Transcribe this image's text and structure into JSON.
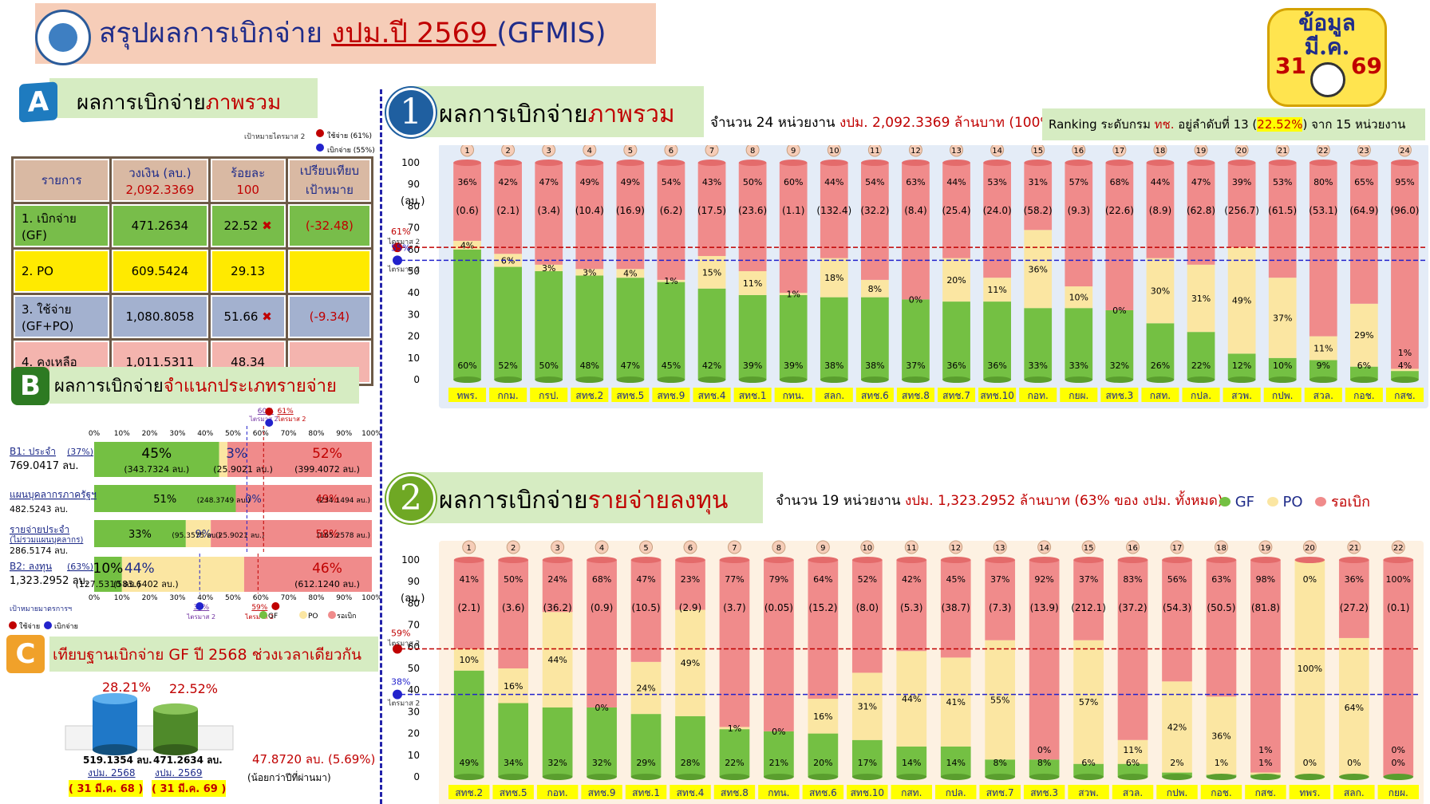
{
  "header": {
    "title_pre": "สรุปผลการเบิกจ่าย ",
    "title_u": "งปม.ปี 2569 ",
    "title_post": "(GFMIS)"
  },
  "clock": {
    "label1": "ข้อมูล",
    "label2": "มี.ค.",
    "day": "31",
    "year": "69"
  },
  "secA": {
    "letter": "A",
    "pre": "ผลการเบิกจ่าย",
    "hl": "ภาพรวม",
    "legend_target": "เป้าหมายไตรมาส 2",
    "legend_spend": "ใช้จ่าย (61%)",
    "legend_disb": "เบิกจ่าย (55%)"
  },
  "tableA": {
    "headers": [
      "รายการ",
      "วงเงิน (ลบ.)",
      "ร้อยละ",
      "เปรียบเทียบ"
    ],
    "headers2": [
      "",
      "2,092.3369",
      "100",
      "เป้าหมาย"
    ],
    "rows": [
      {
        "c1": "1. เบิกจ่าย",
        "c1b": "(GF)",
        "c2": "471.2634",
        "c3": "22.52",
        "c4": "(-32.48)",
        "x": "✖"
      },
      {
        "c1": "2. PO",
        "c1b": "",
        "c2": "609.5424",
        "c3": "29.13",
        "c4": "",
        "x": ""
      },
      {
        "c1": "3. ใช้จ่าย",
        "c1b": "(GF+PO)",
        "c2": "1,080.8058",
        "c3": "51.66",
        "c4": "(-9.34)",
        "x": "✖"
      },
      {
        "c1": "4. คงเหลือ",
        "c1b": "",
        "c2": "1,011.5311",
        "c3": "48.34",
        "c4": "",
        "x": ""
      }
    ]
  },
  "secB": {
    "letter": "B",
    "pre": "ผลการเบิกจ่าย",
    "hl": "จำแนกประเภทรายจ่าย",
    "ticks": [
      "0%",
      "10%",
      "20%",
      "30%",
      "40%",
      "50%",
      "60%",
      "70%",
      "80%",
      "90%",
      "100%"
    ],
    "mark60": "60%",
    "mark60b": "ไตรมาส 2",
    "mark61": "61%",
    "mark61b": "ไตรมาส 2",
    "rows": [
      {
        "lbl": "B1: ประจำ",
        "pct": "(37%)",
        "amt": "769.0417 ลบ.",
        "gf": "45%",
        "gf_amt": "(343.7324 ลบ.)",
        "po": "3%",
        "po_amt": "(25.9021 ลบ.)",
        "rem": "52%",
        "rem_amt": "(399.4072 ลบ.)",
        "g": 45,
        "p": 3
      },
      {
        "lbl": "แผนบุคลากรภาครัฐฯ",
        "pct": "",
        "amt": "482.5243 ลบ.",
        "gf": "51%",
        "gf_amt": "(248.3749 ลบ.)",
        "po": "0%",
        "po_amt": "",
        "rem": "49%",
        "rem_amt": "(234.1494 ลบ.)",
        "g": 51,
        "p": 0
      },
      {
        "lbl": "รายจ่ายประจำ",
        "pct": "(ไม่รวมแผนบุคลากร)",
        "amt": "286.5174 ลบ.",
        "gf": "33%",
        "gf_amt": "(95.3575 ลบ.)",
        "po": "9%",
        "po_amt": "(25.9021 ลบ.)",
        "rem": "58%",
        "rem_amt": "(165.2578 ลบ.)",
        "g": 33,
        "p": 9
      },
      {
        "lbl": "B2: ลงทุน",
        "pct": "(63%)",
        "amt": "1,323.2952 ลบ.",
        "gf": "10%",
        "gf_amt": "(127.5310 ลบ.)",
        "po": "44%",
        "po_amt": "(583.6402 ลบ.)",
        "rem": "46%",
        "rem_amt": "(612.1240 ลบ.)",
        "g": 10,
        "p": 44
      }
    ],
    "mark38": "38%",
    "mark38b": "ไตรมาส 2",
    "mark59": "59%",
    "mark59b": "ไตรมาส 2",
    "legend_target": "เป้าหมายมาตรการฯ",
    "legend_spend": "ใช้จ่าย",
    "legend_disb": "เบิกจ่าย",
    "legend": [
      "GF",
      "PO",
      "รอเบิก"
    ]
  },
  "secC": {
    "letter": "C",
    "pre": "เทียบฐานเบิกจ่าย ",
    "gf": "GF",
    "post": " ปี 2568 ",
    "hl": "ช่วงเวลาเดียวกัน",
    "pct68": "28.21%",
    "pct69": "22.52%",
    "v68": "519.1354 ลบ.",
    "v69": "471.2634 ลบ.",
    "y68": "งปม. 2568",
    "y69": "งปม. 2569",
    "d68": "( 31 มี.ค. 68 )",
    "d69": "( 31 มี.ค. 69 )",
    "diff": "47.8720 ลบ. (5.69%)",
    "diff_note": "(น้อยกว่าปีที่ผ่านมา)",
    "frac68": 0.2821,
    "frac69": 0.2252
  },
  "chart1": {
    "num": "1",
    "pre": "ผลการเบิกจ่าย",
    "hl": "ภาพรวม",
    "count_a": "จำนวน 24 หน่วยงาน ",
    "count_b": "งปม. 2,092.3369 ล้านบาท (100%)",
    "rank_a": "Ranking ระดับกรม ",
    "rank_b": "ทช.",
    "rank_c": " อยู่ลำดับที่ 13 (",
    "rank_d": "22.52%",
    "rank_e": ") จาก 15 หน่วยงาน",
    "unit": "(ลบ.)",
    "t61": "61%",
    "t61b": "ไตรมาส 2",
    "t55": "55%",
    "t55b": "ไตรมาส 2",
    "yticks": [
      "0",
      "10",
      "20",
      "30",
      "40",
      "50",
      "60",
      "70",
      "80",
      "90",
      "100"
    ]
  },
  "chart2": {
    "num": "2",
    "pre": "ผลการเบิกจ่าย",
    "hl": "รายจ่ายลงทุน",
    "count_a": "จำนวน 19 หน่วยงาน ",
    "count_b": "งปม. 1,323.2952 ล้านบาท (63% ของ งปม. ทั้งหมด)",
    "legend": [
      "GF",
      "PO",
      "รอเบิก"
    ],
    "unit": "(ลบ.)",
    "t59": "59%",
    "t59b": "ไตรมาส 2",
    "t38": "38%",
    "t38b": "ไตรมาส 2",
    "yticks": [
      "0",
      "10",
      "20",
      "30",
      "40",
      "50",
      "60",
      "70",
      "80",
      "90",
      "100"
    ]
  },
  "chart_data": [
    {
      "type": "bar",
      "stacked": true,
      "title": "ผลการเบิกจ่ายภาพรวม",
      "ylim": [
        0,
        100
      ],
      "categories": [
        "ทพร.",
        "กกม.",
        "กรป.",
        "สทช.2",
        "สทช.5",
        "สทช.9",
        "สทช.4",
        "สทช.1",
        "กทน.",
        "สลก.",
        "สทช.6",
        "สทช.8",
        "สทช.7",
        "สทช.10",
        "กอท.",
        "กยผ.",
        "สทช.3",
        "กสท.",
        "กปล.",
        "สวพ.",
        "กปพ.",
        "สวล.",
        "กอช.",
        "กสช."
      ],
      "ranks": [
        "1",
        "2",
        "3",
        "4",
        "5",
        "6",
        "7",
        "8",
        "9",
        "10",
        "11",
        "12",
        "13",
        "14",
        "15",
        "16",
        "17",
        "18",
        "19",
        "20",
        "21",
        "22",
        "23",
        "24"
      ],
      "series": [
        {
          "name": "GF",
          "values": [
            60,
            52,
            50,
            48,
            47,
            45,
            42,
            39,
            39,
            38,
            38,
            37,
            36,
            36,
            33,
            33,
            32,
            26,
            22,
            12,
            10,
            9,
            6,
            4
          ],
          "labels": [
            "60%",
            "52%",
            "50%",
            "48%",
            "47%",
            "45%",
            "42%",
            "39%",
            "39%",
            "38%",
            "38%",
            "37%",
            "36%",
            "36%",
            "33%",
            "33%",
            "32%",
            "26%",
            "22%",
            "12%",
            "10%",
            "9%",
            "6%",
            "4%"
          ]
        },
        {
          "name": "PO",
          "values": [
            4,
            6,
            3,
            3,
            4,
            1,
            15,
            11,
            1,
            18,
            8,
            0,
            20,
            11,
            36,
            10,
            0,
            30,
            31,
            49,
            37,
            11,
            29,
            1
          ],
          "labels": [
            "4%",
            "6%",
            "3%",
            "3%",
            "4%",
            "1%",
            "15%",
            "11%",
            "1%",
            "18%",
            "8%",
            "0%",
            "20%",
            "11%",
            "36%",
            "10%",
            "0%",
            "30%",
            "31%",
            "49%",
            "37%",
            "11%",
            "29%",
            "1%"
          ]
        },
        {
          "name": "รอเบิก",
          "values": [
            36,
            42,
            47,
            49,
            49,
            54,
            43,
            50,
            60,
            44,
            54,
            63,
            44,
            53,
            31,
            57,
            68,
            44,
            47,
            39,
            53,
            80,
            65,
            95
          ],
          "labels": [
            "36%",
            "42%",
            "47%",
            "49%",
            "49%",
            "54%",
            "43%",
            "50%",
            "60%",
            "44%",
            "54%",
            "63%",
            "44%",
            "53%",
            "31%",
            "57%",
            "68%",
            "44%",
            "47%",
            "39%",
            "53%",
            "80%",
            "65%",
            "95%"
          ]
        }
      ],
      "remain_amount": [
        "(0.6)",
        "(2.1)",
        "(3.4)",
        "(10.4)",
        "(16.9)",
        "(6.2)",
        "(17.5)",
        "(23.6)",
        "(1.1)",
        "(132.4)",
        "(32.2)",
        "(8.4)",
        "(25.4)",
        "(24.0)",
        "(58.2)",
        "(9.3)",
        "(22.6)",
        "(8.9)",
        "(62.8)",
        "(256.7)",
        "(61.5)",
        "(53.1)",
        "(64.9)",
        "(96.0)"
      ],
      "target_spend": 61,
      "target_disb": 55
    },
    {
      "type": "bar",
      "stacked": true,
      "title": "ผลการเบิกจ่ายรายจ่ายลงทุน",
      "ylim": [
        0,
        100
      ],
      "categories": [
        "สทช.2",
        "สทช.5",
        "กอท.",
        "สทช.9",
        "สทช.1",
        "สทช.4",
        "สทช.8",
        "กทน.",
        "สทช.6",
        "สทช.10",
        "กสท.",
        "กปล.",
        "สทช.7",
        "สทช.3",
        "สวพ.",
        "สวล.",
        "กปพ.",
        "กอช.",
        "กสช.",
        "ทพร.",
        "สลก.",
        "กยผ."
      ],
      "ranks": [
        "1",
        "2",
        "3",
        "4",
        "5",
        "6",
        "7",
        "8",
        "9",
        "10",
        "11",
        "12",
        "13",
        "14",
        "15",
        "16",
        "17",
        "18",
        "19",
        "20",
        "21",
        "22"
      ],
      "series": [
        {
          "name": "GF",
          "values": [
            49,
            34,
            32,
            32,
            29,
            28,
            22,
            21,
            20,
            17,
            14,
            14,
            8,
            8,
            6,
            6,
            2,
            1,
            1,
            0,
            0,
            0
          ],
          "labels": [
            "49%",
            "34%",
            "32%",
            "32%",
            "29%",
            "28%",
            "22%",
            "21%",
            "20%",
            "17%",
            "14%",
            "14%",
            "8%",
            "8%",
            "6%",
            "6%",
            "2%",
            "1%",
            "1%",
            "0%",
            "0%",
            "0%"
          ]
        },
        {
          "name": "PO",
          "values": [
            10,
            16,
            44,
            0,
            24,
            49,
            1,
            0,
            16,
            31,
            44,
            41,
            55,
            0,
            57,
            11,
            42,
            36,
            1,
            100,
            64,
            0
          ],
          "labels": [
            "10%",
            "16%",
            "44%",
            "0%",
            "24%",
            "49%",
            "1%",
            "0%",
            "16%",
            "31%",
            "44%",
            "41%",
            "55%",
            "0%",
            "57%",
            "11%",
            "42%",
            "36%",
            "1%",
            "100%",
            "64%",
            "0%"
          ]
        },
        {
          "name": "รอเบิก",
          "values": [
            41,
            50,
            24,
            68,
            47,
            23,
            77,
            79,
            64,
            52,
            42,
            45,
            37,
            92,
            37,
            83,
            56,
            63,
            98,
            0,
            36,
            100
          ],
          "labels": [
            "41%",
            "50%",
            "24%",
            "68%",
            "47%",
            "23%",
            "77%",
            "79%",
            "64%",
            "52%",
            "42%",
            "45%",
            "37%",
            "92%",
            "37%",
            "83%",
            "56%",
            "63%",
            "98%",
            "0%",
            "36%",
            "100%"
          ]
        }
      ],
      "remain_amount": [
        "(2.1)",
        "(3.6)",
        "(36.2)",
        "(0.9)",
        "(10.5)",
        "(2.9)",
        "(3.7)",
        "(0.05)",
        "(15.2)",
        "(8.0)",
        "(5.3)",
        "(38.7)",
        "(7.3)",
        "(13.9)",
        "(212.1)",
        "(37.2)",
        "(54.3)",
        "(50.5)",
        "(81.8)",
        "",
        "(27.2)",
        "(0.1)"
      ],
      "target_spend": 59,
      "target_disb": 38
    }
  ],
  "colors": {
    "gf": "#74c043",
    "po": "#fbe6a2",
    "rem": "#f08b8b",
    "blue": "#1f2c8a",
    "red": "#c00000",
    "panel": "#d6ecc2"
  }
}
